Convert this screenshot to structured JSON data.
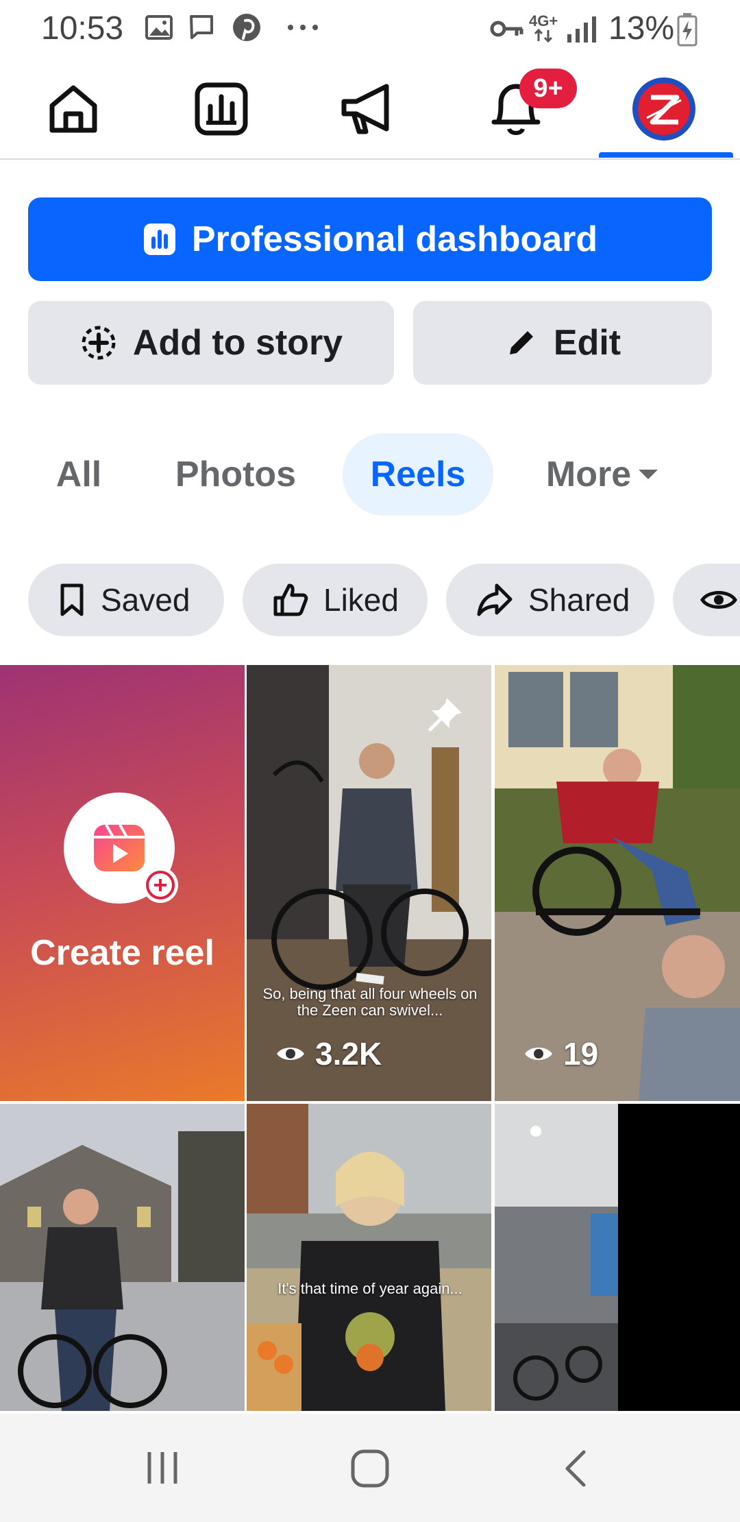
{
  "status_bar": {
    "time": "10:53",
    "network": "4G+",
    "battery": "13%",
    "icons": [
      "gallery-icon",
      "message-icon",
      "pinterest-icon",
      "more-dots-icon",
      "key-icon",
      "signal-icon",
      "battery-icon"
    ]
  },
  "top_nav": {
    "items": [
      {
        "name": "home",
        "icon": "home-icon"
      },
      {
        "name": "insights",
        "icon": "bar-chart-icon"
      },
      {
        "name": "ads",
        "icon": "megaphone-icon"
      },
      {
        "name": "notifications",
        "icon": "bell-icon"
      },
      {
        "name": "profile",
        "icon": "avatar"
      }
    ],
    "notification_badge": "9+",
    "active": "profile"
  },
  "actions": {
    "dashboard_label": "Professional dashboard",
    "add_story_label": "Add to story",
    "edit_label": "Edit"
  },
  "tabs": {
    "all": "All",
    "photos": "Photos",
    "reels": "Reels",
    "more": "More",
    "active": "Reels"
  },
  "chips": {
    "saved": "Saved",
    "liked": "Liked",
    "shared": "Shared"
  },
  "grid": {
    "create_reel_label": "Create reel",
    "reels": [
      {
        "caption": "So, being that all four wheels on the Zeen can swivel...",
        "views": "3.2K",
        "pinned": true
      },
      {
        "caption": "",
        "views": "19",
        "pinned": false
      },
      {
        "caption": "",
        "views": "",
        "pinned": false
      },
      {
        "caption": "It's that time of year again...",
        "views": "",
        "pinned": false
      },
      {
        "caption": "",
        "views": "",
        "pinned": false
      }
    ]
  },
  "colors": {
    "brand_blue": "#0866ff",
    "badge_red": "#e41e3f",
    "chip_gray": "#e4e6eb",
    "tab_active_bg": "#e7f3ff"
  }
}
